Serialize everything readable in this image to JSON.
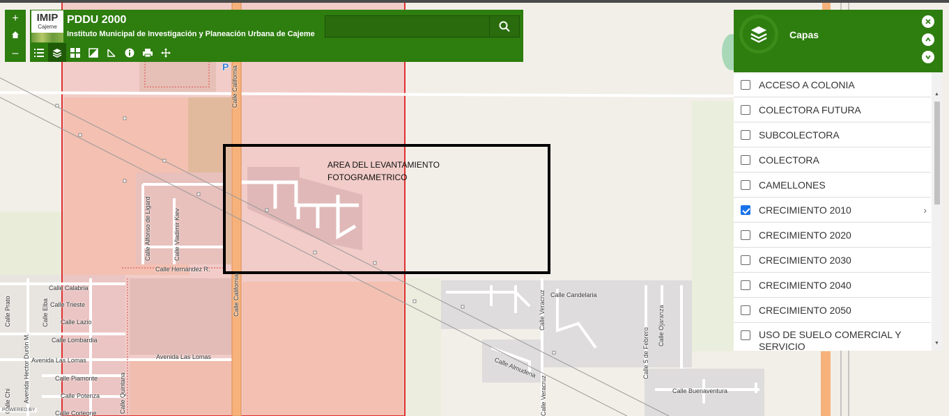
{
  "app": {
    "title": "PDDU 2000",
    "subtitle": "Instituto Municipal de Investigación y Planeación Urbana de Cajeme",
    "logo_text": "IMIP",
    "logo_sub": "Cajeme"
  },
  "zoom": {
    "plus": "+",
    "home": "⌂",
    "minus": "–"
  },
  "search": {
    "placeholder": "",
    "value": ""
  },
  "toolbar": {
    "tools": [
      "list-icon",
      "layers-icon",
      "basemap-icon",
      "measure-area-icon",
      "measure-ruler-icon",
      "info-icon",
      "print-icon",
      "move-icon"
    ]
  },
  "panel": {
    "title": "Capas",
    "layers": [
      {
        "label": "ACCESO A COLONIA",
        "checked": false
      },
      {
        "label": "COLECTORA FUTURA",
        "checked": false
      },
      {
        "label": "SUBCOLECTORA",
        "checked": false
      },
      {
        "label": "COLECTORA",
        "checked": false
      },
      {
        "label": "CAMELLONES",
        "checked": false
      },
      {
        "label": "CRECIMIENTO 2010",
        "checked": true
      },
      {
        "label": "CRECIMIENTO 2020",
        "checked": false
      },
      {
        "label": "CRECIMIENTO 2030",
        "checked": false
      },
      {
        "label": "CRECIMIENTO 2040",
        "checked": false
      },
      {
        "label": "CRECIMIENTO 2050",
        "checked": false
      },
      {
        "label": "USO DE SUELO COMERCIAL Y SERVICIO",
        "checked": false
      }
    ]
  },
  "map": {
    "annotation_line1": "AREA DEL LEVANTAMIENTO",
    "annotation_line2": "FOTOGRAMETRICO",
    "powered_by": "POWERED BY",
    "parking": "P",
    "streets": {
      "california_top": "Calle California",
      "california_bottom": "Calle California",
      "alfonso": "Calle Alfonso de Ligard",
      "vladimir": "Calle Vladimir Kiev",
      "hernandez": "Calle Hernández R.",
      "calabria": "Calle Calabria",
      "trieste": "Calle Trieste",
      "lazio": "Calle Lazio",
      "lombardia": "Calle Lombardia",
      "lomas_left": "Avenida Las Lomas",
      "lomas_right": "Avenida Las Lomas",
      "piamonte": "Calle Piamonte",
      "potenza": "Calle Potenza",
      "corleone": "Calle Corleone",
      "prato": "Calle Prato",
      "elba": "Calle Elba",
      "hector": "Avenida Hector Durón M.",
      "quintana": "Calle Quintana",
      "chi": "Calle Chi",
      "candelaria": "Calle Candelaria",
      "veracruz_top": "Calle Veracruz",
      "veracruz_bottom": "Calle Veracruz",
      "almudena": "Calle Almudena",
      "febrero": "Calle 5 de Febrero",
      "ojaranza": "Calle Ojaranza",
      "buenaventura": "Calle Buenaventura"
    }
  }
}
